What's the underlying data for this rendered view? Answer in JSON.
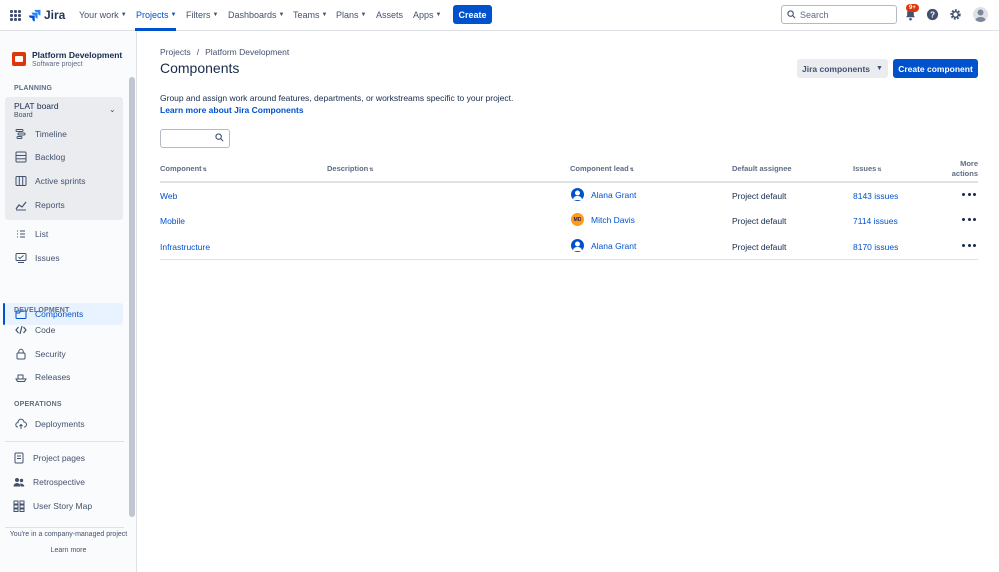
{
  "topnav": {
    "logo": "Jira",
    "items": [
      "Your work",
      "Projects",
      "Filters",
      "Dashboards",
      "Teams",
      "Plans",
      "Assets",
      "Apps"
    ],
    "create": "Create",
    "search_placeholder": "Search",
    "notification_count": "9+",
    "colors": {
      "brand": "#0052cc",
      "badge": "#de350b"
    }
  },
  "sidebar": {
    "project_name": "Platform Development",
    "project_type": "Software project",
    "planning_label": "PLANNING",
    "board_title": "PLAT board",
    "board_sub": "Board",
    "board_items": [
      "Timeline",
      "Backlog",
      "Active sprints",
      "Reports"
    ],
    "items": [
      "List",
      "Issues",
      "Components"
    ],
    "development_label": "DEVELOPMENT",
    "development_items": [
      "Code",
      "Security",
      "Releases"
    ],
    "operations_label": "OPERATIONS",
    "operations_items": [
      "Deployments"
    ],
    "other_items": [
      "Project pages",
      "Retrospective",
      "User Story Map"
    ],
    "footer_note": "You're in a company-managed project",
    "footer_link": "Learn more"
  },
  "main": {
    "breadcrumbs": [
      "Projects",
      "Platform Development"
    ],
    "breadcrumb_sep": "/",
    "title": "Components",
    "jira_components_button": "Jira components",
    "create_component_button": "Create component",
    "description": "Group and assign work around features, departments, or workstreams specific to your project.",
    "learn_more": "Learn more about Jira Components",
    "headers": {
      "component": "Component",
      "description": "Description",
      "lead": "Component lead",
      "assignee": "Default assignee",
      "issues": "Issues",
      "more": "More actions"
    },
    "rows": [
      {
        "component": "Web",
        "lead": "Alana Grant",
        "lead_initials": "",
        "assignee": "Project default",
        "issues": "8143 issues"
      },
      {
        "component": "Mobile",
        "lead": "Mitch Davis",
        "lead_initials": "MD",
        "assignee": "Project default",
        "issues": "7114 issues"
      },
      {
        "component": "Infrastructure",
        "lead": "Alana Grant",
        "lead_initials": "",
        "assignee": "Project default",
        "issues": "8170 issues"
      }
    ]
  }
}
